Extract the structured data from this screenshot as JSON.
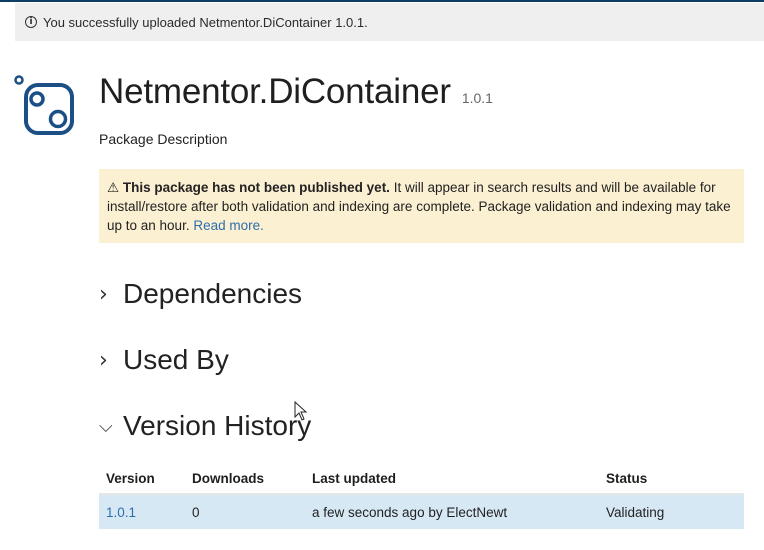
{
  "alert": {
    "icon": "info-circle-icon",
    "text": "You successfully uploaded Netmentor.DiContainer 1.0.1."
  },
  "package": {
    "title": "Netmentor.DiContainer",
    "version": "1.0.1",
    "description": "Package Description",
    "logo_icon": "package-logo-icon"
  },
  "warning": {
    "icon": "warning-triangle-icon",
    "strong": "This package has not been published yet.",
    "body": " It will appear in search results and will be available for install/restore after both validation and indexing are complete. Package validation and indexing may take up to an hour. ",
    "link": "Read more."
  },
  "sections": {
    "dependencies": "Dependencies",
    "used_by": "Used By",
    "version_history": "Version History"
  },
  "history_table": {
    "headers": [
      "Version",
      "Downloads",
      "Last updated",
      "Status"
    ],
    "rows": [
      {
        "version": "1.0.1",
        "downloads": "0",
        "last_updated": "a few seconds ago by ElectNewt",
        "status": "Validating"
      }
    ]
  },
  "colors": {
    "accent": "#2c6dab",
    "warning_bg": "#fcf0d3",
    "row_highlight": "#d7e8f5",
    "logo": "#1b4f86"
  }
}
